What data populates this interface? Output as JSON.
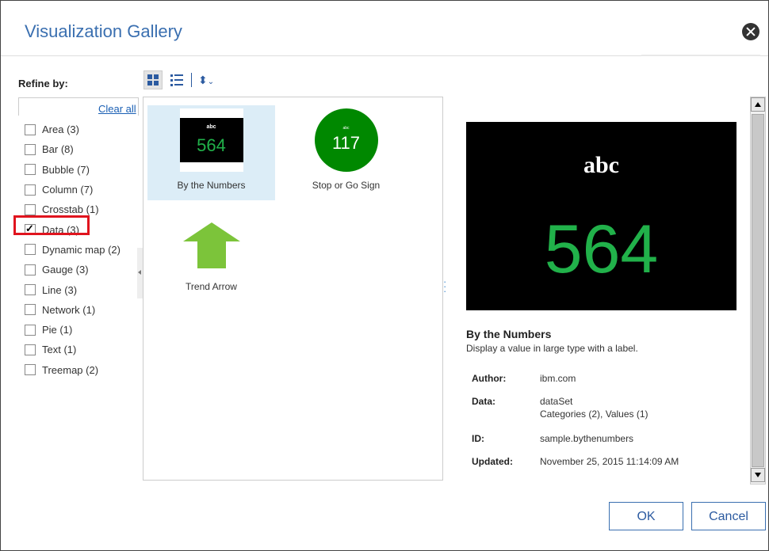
{
  "dialog": {
    "title": "Visualization Gallery"
  },
  "refine": {
    "label": "Refine by:",
    "clear_all": "Clear all",
    "filters": [
      {
        "label": "Area (3)",
        "checked": false
      },
      {
        "label": "Bar (8)",
        "checked": false
      },
      {
        "label": "Bubble (7)",
        "checked": false
      },
      {
        "label": "Column (7)",
        "checked": false
      },
      {
        "label": "Crosstab (1)",
        "checked": false
      },
      {
        "label": "Data (3)",
        "checked": true
      },
      {
        "label": "Dynamic map (2)",
        "checked": false
      },
      {
        "label": "Gauge (3)",
        "checked": false
      },
      {
        "label": "Line (3)",
        "checked": false
      },
      {
        "label": "Network (1)",
        "checked": false
      },
      {
        "label": "Pie (1)",
        "checked": false
      },
      {
        "label": "Text (1)",
        "checked": false
      },
      {
        "label": "Treemap (2)",
        "checked": false
      }
    ]
  },
  "gallery": {
    "items": [
      {
        "label": "By the Numbers",
        "thumb_top": "abc",
        "thumb_value": "564",
        "selected": true
      },
      {
        "label": "Stop or Go Sign",
        "thumb_top": "abc",
        "thumb_value": "117",
        "selected": false
      },
      {
        "label": "Trend Arrow",
        "selected": false
      }
    ]
  },
  "preview": {
    "image_top": "abc",
    "image_value": "564",
    "name": "By the Numbers",
    "description": "Display a value in large type with a label.",
    "author_label": "Author:",
    "author": "ibm.com",
    "data_label": "Data:",
    "data_line1": "dataSet",
    "data_line2": "Categories (2),  Values (1)",
    "id_label": "ID:",
    "id": "sample.bythenumbers",
    "updated_label": "Updated:",
    "updated": "November 25, 2015 11:14:09 AM"
  },
  "buttons": {
    "ok": "OK",
    "cancel": "Cancel"
  },
  "colors": {
    "accent": "#3a6fb0",
    "highlight": "#e0141e",
    "number_green": "#21b14a",
    "stop_green": "#008800",
    "arrow_green": "#7cc43a",
    "selected_bg": "#dcedf7"
  }
}
